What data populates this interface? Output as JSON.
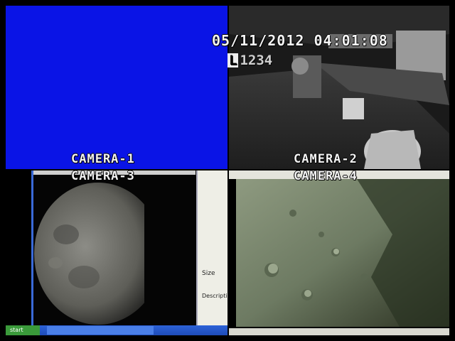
{
  "osd": {
    "datetime": "05/11/2012 04:01:08",
    "channel_mark": "L",
    "channels": "1234"
  },
  "cameras": [
    {
      "label": "CAMERA-1",
      "state": "no signal (solid blue)",
      "color": "#0a14e6"
    },
    {
      "label": "CAMERA-2",
      "state": "monochrome room view"
    },
    {
      "label": "CAMERA-3",
      "state": "desktop capture: moon image"
    },
    {
      "label": "CAMERA-4",
      "state": "desktop capture: lunar surface"
    }
  ],
  "cam3_screen": {
    "start_label": "start",
    "side_heading": "Size",
    "side_heading2": "Descripti"
  },
  "colors": {
    "no_signal_blue": "#0a14e6",
    "xp_taskbar": "#2258d0",
    "xp_start": "#3a9a3a"
  }
}
